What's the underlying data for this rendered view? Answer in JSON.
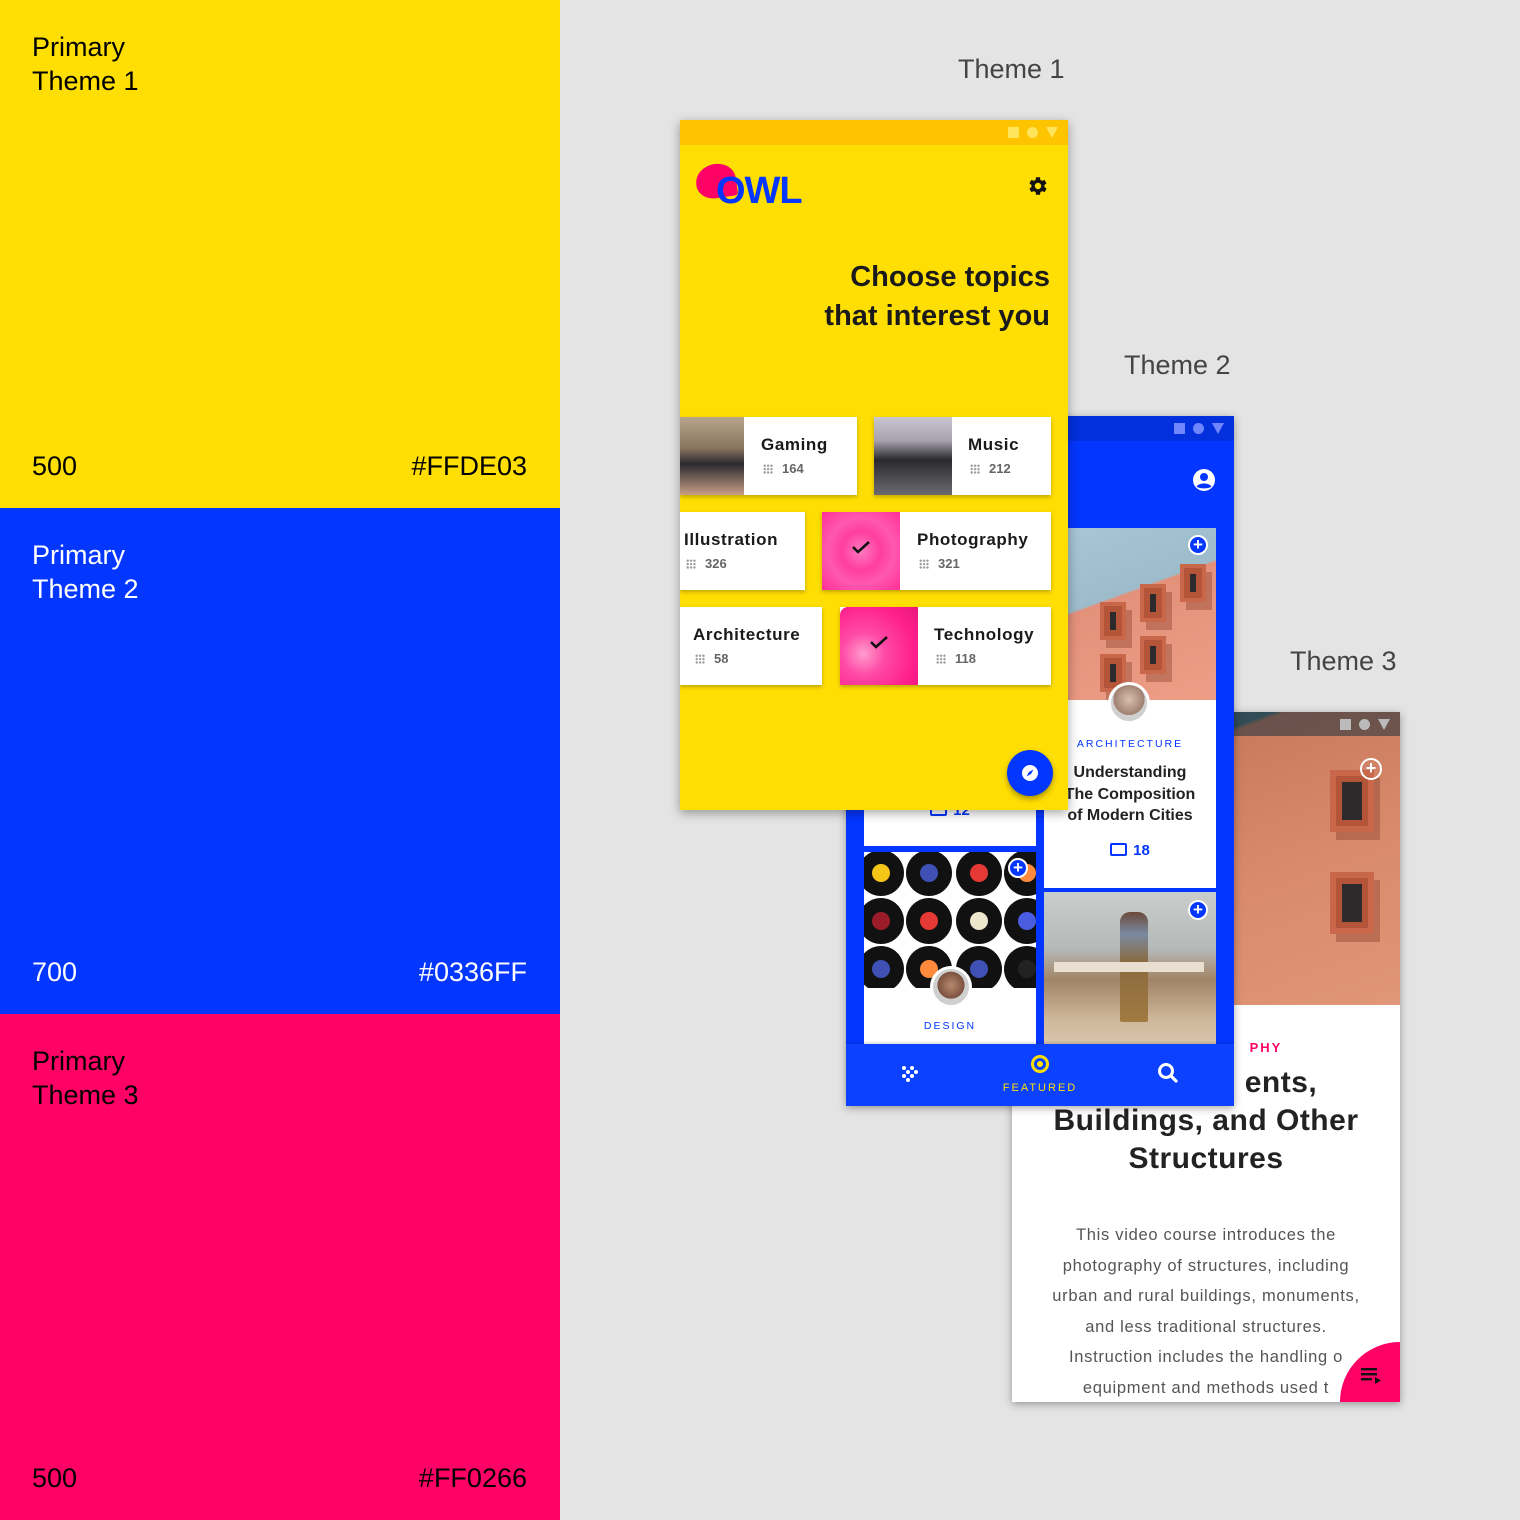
{
  "swatches": [
    {
      "name_line1": "Primary",
      "name_line2": "Theme 1",
      "weight": "500",
      "hex": "#FFDE03"
    },
    {
      "name_line1": "Primary",
      "name_line2": "Theme 2",
      "weight": "700",
      "hex": "#0336FF"
    },
    {
      "name_line1": "Primary",
      "name_line2": "Theme 3",
      "weight": "500",
      "hex": "#FF0266"
    }
  ],
  "theme_labels": [
    "Theme 1",
    "Theme 2",
    "Theme 3"
  ],
  "colors": {
    "yellow": "#FFDE03",
    "blue": "#0336FF",
    "pink": "#FF0266",
    "canvas": "#E4E4E4"
  },
  "theme1": {
    "logo": "OWL",
    "headline_line1": "Choose topics",
    "headline_line2": "that interest you",
    "topics": [
      {
        "name": "Gaming",
        "count": "164",
        "selected": false
      },
      {
        "name": "Music",
        "count": "212",
        "selected": false
      },
      {
        "name": "Illustration",
        "count": "326",
        "selected": false
      },
      {
        "name": "Photography",
        "count": "321",
        "selected": true
      },
      {
        "name": "Architecture",
        "count": "58",
        "selected": false
      },
      {
        "name": "Technology",
        "count": "118",
        "selected": true
      }
    ],
    "settings_icon": "gear-icon",
    "fab_icon": "compass-icon"
  },
  "theme2": {
    "account_icon": "account-circle-icon",
    "cards": [
      {
        "category": "ARCHITECTURE",
        "title_line1": "Understanding",
        "title_line2": "The Composition",
        "title_line3": "of Modern Cities",
        "lessons": "18"
      },
      {
        "lessons": "12"
      },
      {
        "category": "DESIGN"
      }
    ],
    "nav": {
      "featured_label": "FEATURED"
    }
  },
  "theme3": {
    "category": "PHY",
    "title_line1": "ents,",
    "title_line2": "Buildings, and Other",
    "title_line3": "Structures",
    "description": [
      "This video course introduces the",
      "photography of structures, including",
      "urban and rural buildings, monuments,",
      "and less traditional structures.",
      "Instruction includes the handling o",
      "equipment and methods used t"
    ]
  }
}
